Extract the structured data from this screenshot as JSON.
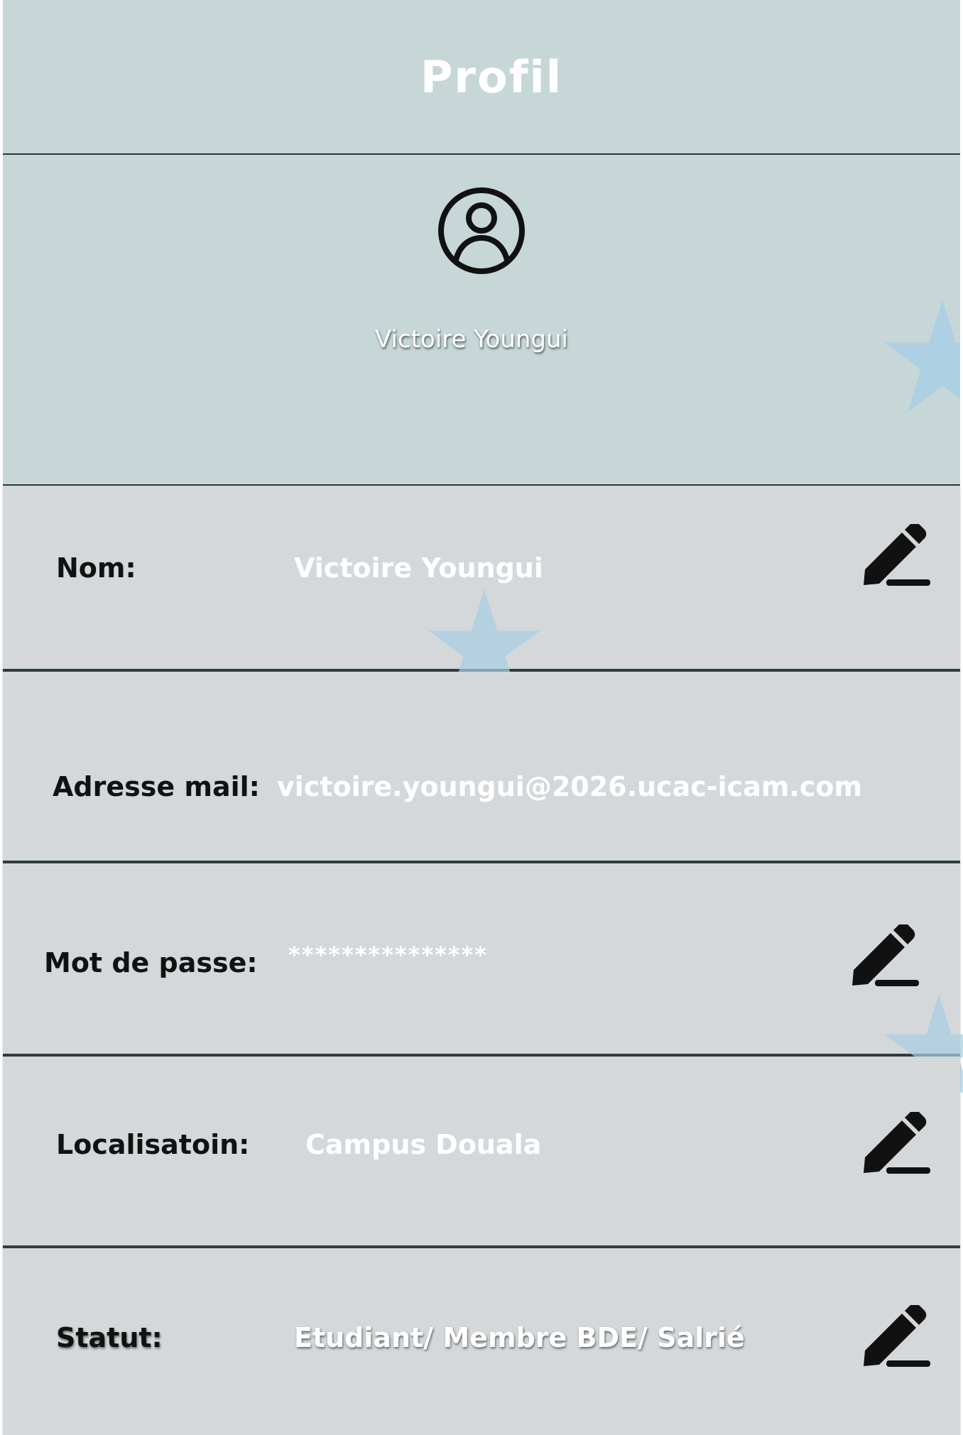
{
  "header": {
    "title": "Profil"
  },
  "profile": {
    "display_name": "Victoire Youngui",
    "avatar_icon": "user-circle-icon"
  },
  "fields": {
    "name": {
      "label": "Nom:",
      "value": "Victoire Youngui",
      "edit_icon": "pencil-icon"
    },
    "email": {
      "label": "Adresse mail:",
      "value": "victoire.youngui@2026.ucac-icam.com"
    },
    "password": {
      "label": "Mot de passe:",
      "value": "***************",
      "edit_icon": "pencil-icon"
    },
    "location": {
      "label": "Localisatoin:",
      "value": "Campus Douala",
      "edit_icon": "pencil-icon"
    },
    "status": {
      "label": "Statut:",
      "value": "Etudiant/ Membre BDE/ Salrié",
      "edit_icon": "pencil-icon"
    }
  },
  "colors": {
    "header_bg": "#c7d7d8",
    "row_bg": "#d4d8da",
    "divider": "#2e3b3d",
    "star": "#a9cfe4"
  }
}
